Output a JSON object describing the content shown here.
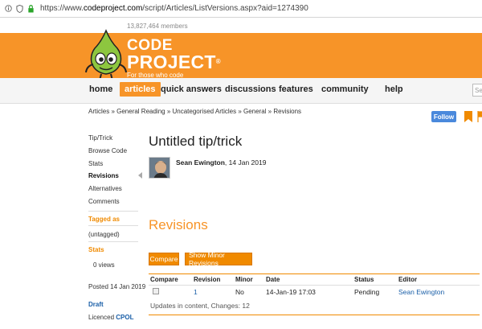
{
  "browser": {
    "url_prefix": "https://www.",
    "url_host": "codeproject.com",
    "url_path": "/script/Articles/ListVersions.aspx?aid=1274390"
  },
  "site": {
    "member_count": "13,827,464 members",
    "logo_code": "CODE",
    "logo_project": "PROJECT",
    "logo_reg": "®",
    "tagline": "For those who code",
    "brand_color": "#f79428"
  },
  "nav": {
    "items": [
      {
        "label": "home"
      },
      {
        "label": "articles"
      },
      {
        "label": "quick answers"
      },
      {
        "label": "discussions"
      },
      {
        "label": "features"
      },
      {
        "label": "community"
      },
      {
        "label": "help"
      }
    ],
    "active": "articles",
    "search_placeholder": "Se"
  },
  "breadcrumb": "Articles » General Reading » Uncategorised Articles » General » Revisions",
  "follow_label": "Follow",
  "sidebar": {
    "links": [
      {
        "label": "Tip/Trick"
      },
      {
        "label": "Browse Code"
      },
      {
        "label": "Stats"
      },
      {
        "label": "Revisions"
      },
      {
        "label": "Alternatives"
      },
      {
        "label": "Comments"
      }
    ],
    "tagged_as_heading": "Tagged as",
    "tagged_value": "(untagged)",
    "stats_heading": "Stats",
    "views": "0 views",
    "posted": "Posted 14 Jan 2019",
    "draft": "Draft",
    "licenced_prefix": "Licenced",
    "licence": "CPOL"
  },
  "article": {
    "title": "Untitled tip/trick",
    "author_name": "Sean Ewington",
    "author_date": ", 14 Jan 2019"
  },
  "revisions": {
    "heading": "Revisions",
    "compare_label": "Compare",
    "show_minor_label": "Show Minor Revisions",
    "columns": {
      "compare": "Compare",
      "revision": "Revision",
      "minor": "Minor",
      "date": "Date",
      "status": "Status",
      "editor": "Editor"
    },
    "rows": [
      {
        "revision": "1",
        "minor": "No",
        "date": "14-Jan-19 17:03",
        "status": "Pending",
        "editor": "Sean Ewington"
      }
    ],
    "updates_note": "Updates in content, Changes: 12"
  }
}
